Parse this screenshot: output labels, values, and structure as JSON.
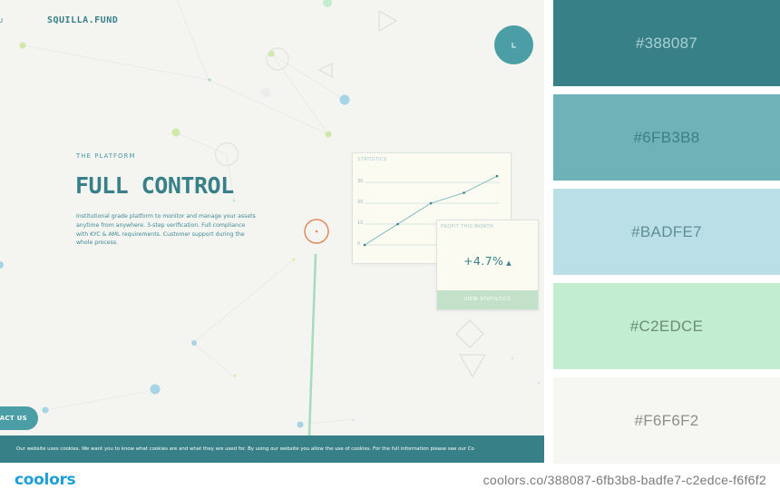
{
  "colors": {
    "accent": "#388087",
    "light_accent": "#6fb3b8",
    "sky": "#badfe7",
    "mint": "#c2edce",
    "background": "#f6f6f2",
    "brand_blue": "#1e9fd9"
  },
  "site": {
    "nav_fragment": "U",
    "brand": "SQUILLA.FUND",
    "menu_icon": "clock-icon",
    "eyebrow": "THE PLATFORM",
    "headline": "FULL CONTROL",
    "description": "Institutional grade platform to monitor and manage your assets anytime from anywhere. 3-step verification. Full compliance with KYC & AML requirements. Customer support during the whole process.",
    "stats_card": {
      "title": "STATISTICS",
      "y_ticks": [
        "30",
        "20",
        "10",
        "0"
      ]
    },
    "chart_data": {
      "type": "line",
      "y_ticks": [
        0,
        10,
        20,
        30
      ],
      "ylim": [
        0,
        30
      ],
      "values": [
        0,
        10,
        20,
        25,
        33
      ]
    },
    "profit_card": {
      "title": "PROFIT THIS MONTH",
      "value": "+4.7%",
      "arrow": "▲",
      "button": "VIEW STATISTICS"
    },
    "contact_button": "TACT US",
    "cookie_text": "Our website uses cookies. We want you to know what cookies are and what they are used for. By using our website you allow the use of cookies. For the full information please see our Co"
  },
  "palette": [
    {
      "hex": "#388087",
      "label": "#388087"
    },
    {
      "hex": "#6fb3b8",
      "label": "#6FB3B8"
    },
    {
      "hex": "#badfe7",
      "label": "#BADFE7"
    },
    {
      "hex": "#c2edce",
      "label": "#C2EDCE"
    },
    {
      "hex": "#f6f6f2",
      "label": "#F6F6F2"
    }
  ],
  "footer": {
    "logo": "coolors",
    "url": "coolors.co/388087-6fb3b8-badfe7-c2edce-f6f6f2"
  }
}
